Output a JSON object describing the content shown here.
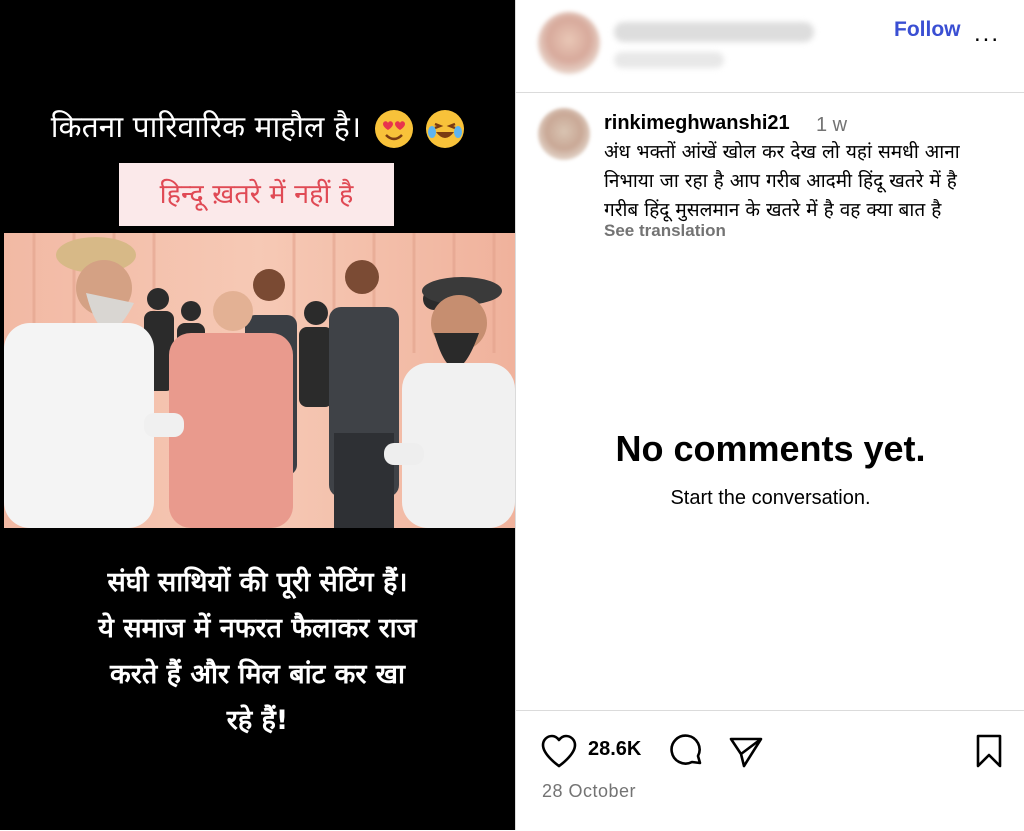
{
  "post": {
    "caption_top": "कितना पारिवारिक माहौल है।",
    "banner": "हिन्दू ख़तरे में नहीं है",
    "caption_bottom_lines": [
      "संघी साथियों की पूरी सेटिंग हैं।",
      "ये समाज में नफरत फैलाकर राज",
      "करते हैं और मिल बांट कर खा",
      "रहे हैं!"
    ]
  },
  "header": {
    "follow_label": "Follow",
    "more_label": "..."
  },
  "comment": {
    "username": "rinkimeghwanshi21",
    "time": "1 w",
    "text_lines": [
      "अंध भक्तों आंखें खोल कर देख लो यहां समधी आना",
      "निभाया जा रहा है आप गरीब आदमी हिंदू खतरे में है",
      "गरीब हिंदू मुसलमान के खतरे में है वह क्या बात है"
    ],
    "see_translation": "See translation"
  },
  "empty": {
    "title": "No comments yet.",
    "subtitle": "Start the conversation."
  },
  "actions": {
    "likes": "28.6K",
    "date": "28 October"
  },
  "colors": {
    "accent": "#3a4fd3",
    "banner_text": "#e04a55",
    "muted": "#737373"
  }
}
